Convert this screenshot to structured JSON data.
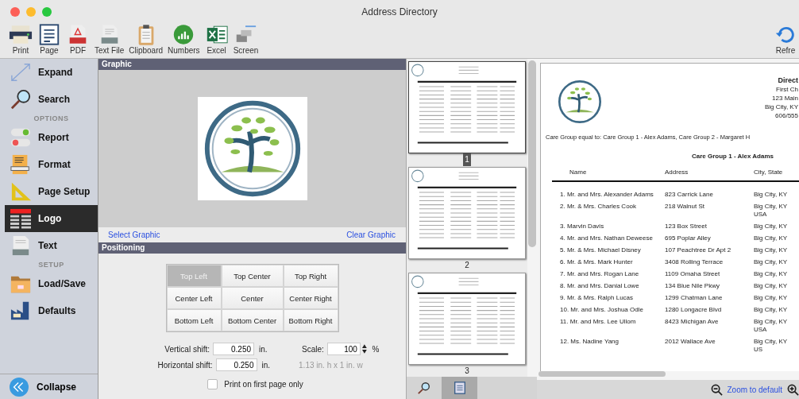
{
  "window": {
    "title": "Address Directory"
  },
  "toolbar": [
    {
      "label": "Print"
    },
    {
      "label": "Page"
    },
    {
      "label": "PDF"
    },
    {
      "label": "Text File"
    },
    {
      "label": "Clipboard"
    },
    {
      "label": "Numbers"
    },
    {
      "label": "Excel"
    },
    {
      "label": "Screen"
    }
  ],
  "toolbar_right": {
    "label": "Refre"
  },
  "sidebar": {
    "items": [
      {
        "kind": "item",
        "label": "Expand",
        "selected": false
      },
      {
        "kind": "item",
        "label": "Search",
        "selected": false
      },
      {
        "kind": "header",
        "label": "OPTIONS"
      },
      {
        "kind": "item",
        "label": "Report",
        "selected": false
      },
      {
        "kind": "item",
        "label": "Format",
        "selected": false
      },
      {
        "kind": "item",
        "label": "Page Setup",
        "selected": false
      },
      {
        "kind": "item",
        "label": "Logo",
        "selected": true
      },
      {
        "kind": "item",
        "label": "Text",
        "selected": false
      },
      {
        "kind": "header",
        "label": "SETUP"
      },
      {
        "kind": "item",
        "label": "Load/Save",
        "selected": false
      },
      {
        "kind": "item",
        "label": "Defaults",
        "selected": false
      }
    ],
    "collapse": "Collapse"
  },
  "graphic": {
    "title": "Graphic",
    "select_link": "Select Graphic",
    "clear_link": "Clear Graphic"
  },
  "positioning": {
    "title": "Positioning",
    "positions": [
      {
        "label": "Top Left",
        "selected": true
      },
      {
        "label": "Top Center",
        "selected": false
      },
      {
        "label": "Top Right",
        "selected": false
      },
      {
        "label": "Center Left",
        "selected": false
      },
      {
        "label": "Center",
        "selected": false
      },
      {
        "label": "Center Right",
        "selected": false
      },
      {
        "label": "Bottom Left",
        "selected": false
      },
      {
        "label": "Bottom Center",
        "selected": false
      },
      {
        "label": "Bottom Right",
        "selected": false
      }
    ],
    "vertical_shift": {
      "label": "Vertical shift:",
      "value": "0.250",
      "unit": "in."
    },
    "horizontal_shift": {
      "label": "Horizontal shift:",
      "value": "0.250",
      "unit": "in."
    },
    "scale": {
      "label": "Scale:",
      "value": "100",
      "unit": "%"
    },
    "size_note": "1.13 in. h x 1 in. w",
    "first_page_only": {
      "label": "Print on first page only",
      "checked": false
    }
  },
  "thumbnails": [
    {
      "page": "1",
      "selected": true
    },
    {
      "page": "2",
      "selected": false
    },
    {
      "page": "3",
      "selected": false
    }
  ],
  "preview": {
    "header": [
      "Direct",
      "First Ch",
      "123 Main",
      "Big City, KY",
      "606/555"
    ],
    "filter": "Care Group equal to: Care Group 1 - Alex Adams, Care Group 2 - Margaret H",
    "group": "Care Group 1 - Alex Adams",
    "columns": [
      "Name",
      "Address",
      "City, State"
    ],
    "rows": [
      {
        "name": "1. Mr. and Mrs. Alexander Adams",
        "address": "823 Carrick Lane",
        "city": [
          "Big City, KY"
        ]
      },
      {
        "name": "2. Mr. & Mrs. Charles Cook",
        "address": "218 Walnut St",
        "city": [
          "Big City, KY",
          "USA"
        ]
      },
      {
        "name": "3. Marvin Davis",
        "address": "123 Box Street",
        "city": [
          "Big City, KY"
        ]
      },
      {
        "name": "4. Mr. and Mrs. Nathan Deweese",
        "address": "695 Poplar Alley",
        "city": [
          "Big City, KY"
        ]
      },
      {
        "name": "5. Mr. & Mrs. Michael Disney",
        "address": "107 Peachtree Dr  Apt 2",
        "city": [
          "Big City, KY"
        ]
      },
      {
        "name": "6. Mr. & Mrs. Mark Hunter",
        "address": "3408 Rolling Terrace",
        "city": [
          "Big City, KY"
        ]
      },
      {
        "name": "7. Mr. and Mrs. Rogan Lane",
        "address": "1109 Omaha Street",
        "city": [
          "Big City, KY"
        ]
      },
      {
        "name": "8. Mr. and Mrs. Danial Lowe",
        "address": "134 Blue Nile Pkwy",
        "city": [
          "Big City, KY"
        ]
      },
      {
        "name": "9. Mr. & Mrs. Ralph Lucas",
        "address": "1299 Chatman Lane",
        "city": [
          "Big City, KY"
        ]
      },
      {
        "name": "10. Mr. and Mrs. Joshua Odle",
        "address": "1280 Longacre Blvd",
        "city": [
          "Big City, KY"
        ]
      },
      {
        "name": "11. Mr. and Mrs. Lee Ullom",
        "address": "8423 Michigan Ave",
        "city": [
          "Big City, KY",
          "USA"
        ]
      },
      {
        "name": "12. Ms. Nadine Yang",
        "address": "2012 Wallace Ave",
        "city": [
          "Big City, KY",
          "US"
        ]
      }
    ],
    "zoom_link": "Zoom to default"
  }
}
